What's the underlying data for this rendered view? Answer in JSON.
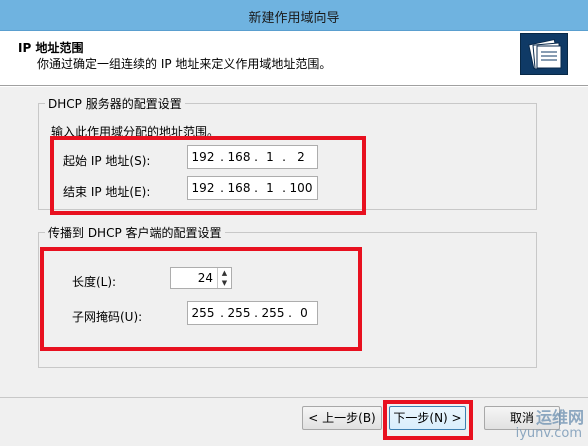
{
  "window": {
    "title": "新建作用域向导"
  },
  "header": {
    "title": "IP 地址范围",
    "subtitle": "你通过确定一组连续的 IP 地址来定义作用域地址范围。"
  },
  "server_group": {
    "legend": "DHCP 服务器的配置设置",
    "instruction": "输入此作用域分配的地址范围。",
    "start_label": "起始 IP 地址(S):",
    "start_ip": [
      "192",
      "168",
      "1",
      "2"
    ],
    "end_label": "结束 IP 地址(E):",
    "end_ip": [
      "192",
      "168",
      "1",
      "100"
    ]
  },
  "client_group": {
    "legend": "传播到 DHCP 客户端的配置设置",
    "length_label": "长度(L):",
    "length_value": "24",
    "mask_label": "子网掩码(U):",
    "mask": [
      "255",
      "255",
      "255",
      "0"
    ]
  },
  "buttons": {
    "back": "< 上一步(B)",
    "next": "下一步(N) >",
    "cancel": "取消"
  },
  "watermark": {
    "line1": "运维网",
    "line2": "iyunv.com"
  },
  "colors": {
    "highlight": "#e8101f",
    "titlebar": "#6fb3e0"
  }
}
